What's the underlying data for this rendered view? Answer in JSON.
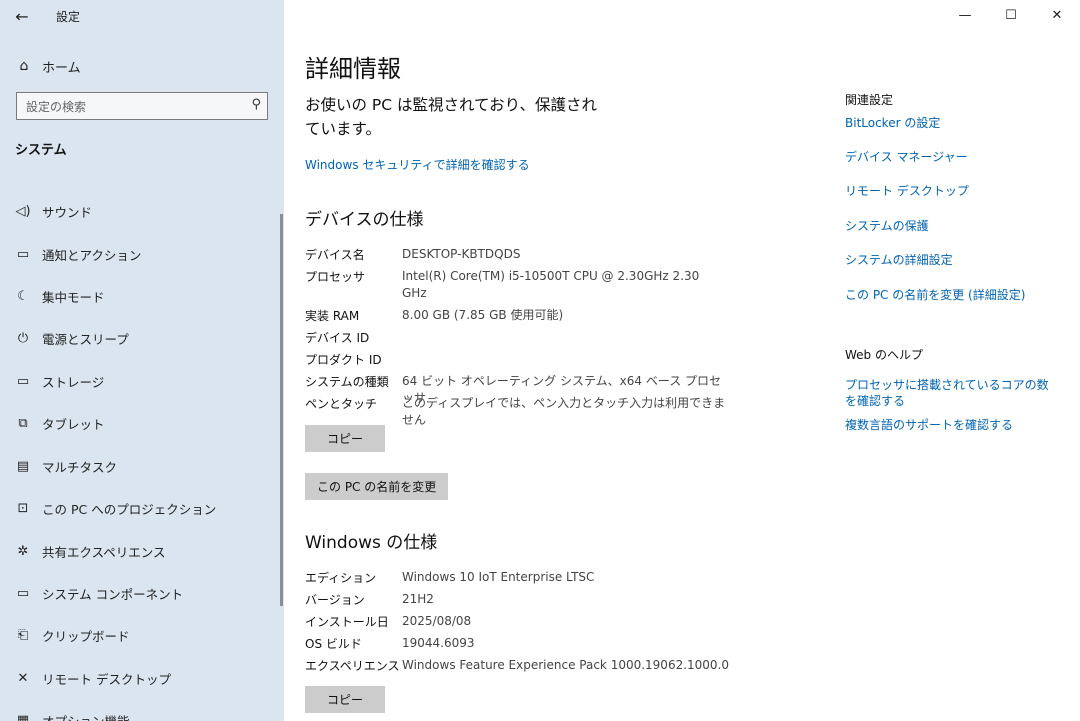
{
  "app": {
    "title": "設定"
  },
  "sidebar": {
    "home_label": "ホーム",
    "search_placeholder": "設定の検索",
    "section": "システム",
    "items": [
      {
        "icon": "speaker-icon",
        "label": "サウンド"
      },
      {
        "icon": "notification-icon",
        "label": "通知とアクション"
      },
      {
        "icon": "moon-icon",
        "label": "集中モード"
      },
      {
        "icon": "power-icon",
        "label": "電源とスリープ"
      },
      {
        "icon": "storage-icon",
        "label": "ストレージ"
      },
      {
        "icon": "tablet-icon",
        "label": "タブレット"
      },
      {
        "icon": "multitask-icon",
        "label": "マルチタスク"
      },
      {
        "icon": "projection-icon",
        "label": "この PC へのプロジェクション"
      },
      {
        "icon": "share-icon",
        "label": "共有エクスペリエンス"
      },
      {
        "icon": "component-icon",
        "label": "システム コンポーネント"
      },
      {
        "icon": "clipboard-icon",
        "label": "クリップボード"
      },
      {
        "icon": "remote-desktop-icon",
        "label": "リモート デスクトップ"
      },
      {
        "icon": "options-icon",
        "label": "オプション機能"
      }
    ]
  },
  "main": {
    "title": "詳細情報",
    "status": "お使いの PC は監視されており、保護されています。",
    "security_link": "Windows セキュリティで詳細を確認する",
    "device_spec": {
      "heading": "デバイスの仕様",
      "rows": [
        {
          "key": "デバイス名",
          "value": "DESKTOP-KBTDQDS"
        },
        {
          "key": "プロセッサ",
          "value": "Intel(R) Core(TM) i5-10500T CPU @ 2.30GHz   2.30 GHz"
        },
        {
          "key": "実装 RAM",
          "value": "8.00 GB (7.85 GB 使用可能)"
        },
        {
          "key": "デバイス ID",
          "value": ""
        },
        {
          "key": "プロダクト ID",
          "value": ""
        },
        {
          "key": "システムの種類",
          "value": "64 ビット オペレーティング システム、x64 ベース プロセッサ"
        },
        {
          "key": "ペンとタッチ",
          "value": "このディスプレイでは、ペン入力とタッチ入力は利用できません"
        }
      ],
      "copy_label": "コピー",
      "rename_label": "この PC の名前を変更"
    },
    "windows_spec": {
      "heading": "Windows の仕様",
      "rows": [
        {
          "key": "エディション",
          "value": "Windows 10 IoT Enterprise LTSC"
        },
        {
          "key": "バージョン",
          "value": "21H2"
        },
        {
          "key": "インストール日",
          "value": "2025/08/08"
        },
        {
          "key": "OS ビルド",
          "value": "19044.6093"
        },
        {
          "key": "エクスペリエンス",
          "value": "Windows Feature Experience Pack 1000.19062.1000.0"
        }
      ],
      "copy_label": "コピー"
    }
  },
  "related": {
    "heading": "関連設定",
    "links": [
      "BitLocker の設定",
      "デバイス マネージャー",
      "リモート デスクトップ",
      "システムの保護",
      "システムの詳細設定",
      "この PC の名前を変更 (詳細設定)"
    ],
    "web_heading": "Web のヘルプ",
    "web_links": [
      "プロセッサに搭載されているコアの数を確認する",
      "複数言語のサポートを確認する"
    ]
  },
  "colors": {
    "sidebar_bg": "#dbe5ef",
    "link": "#0063b1",
    "button_bg": "#cccccc"
  }
}
